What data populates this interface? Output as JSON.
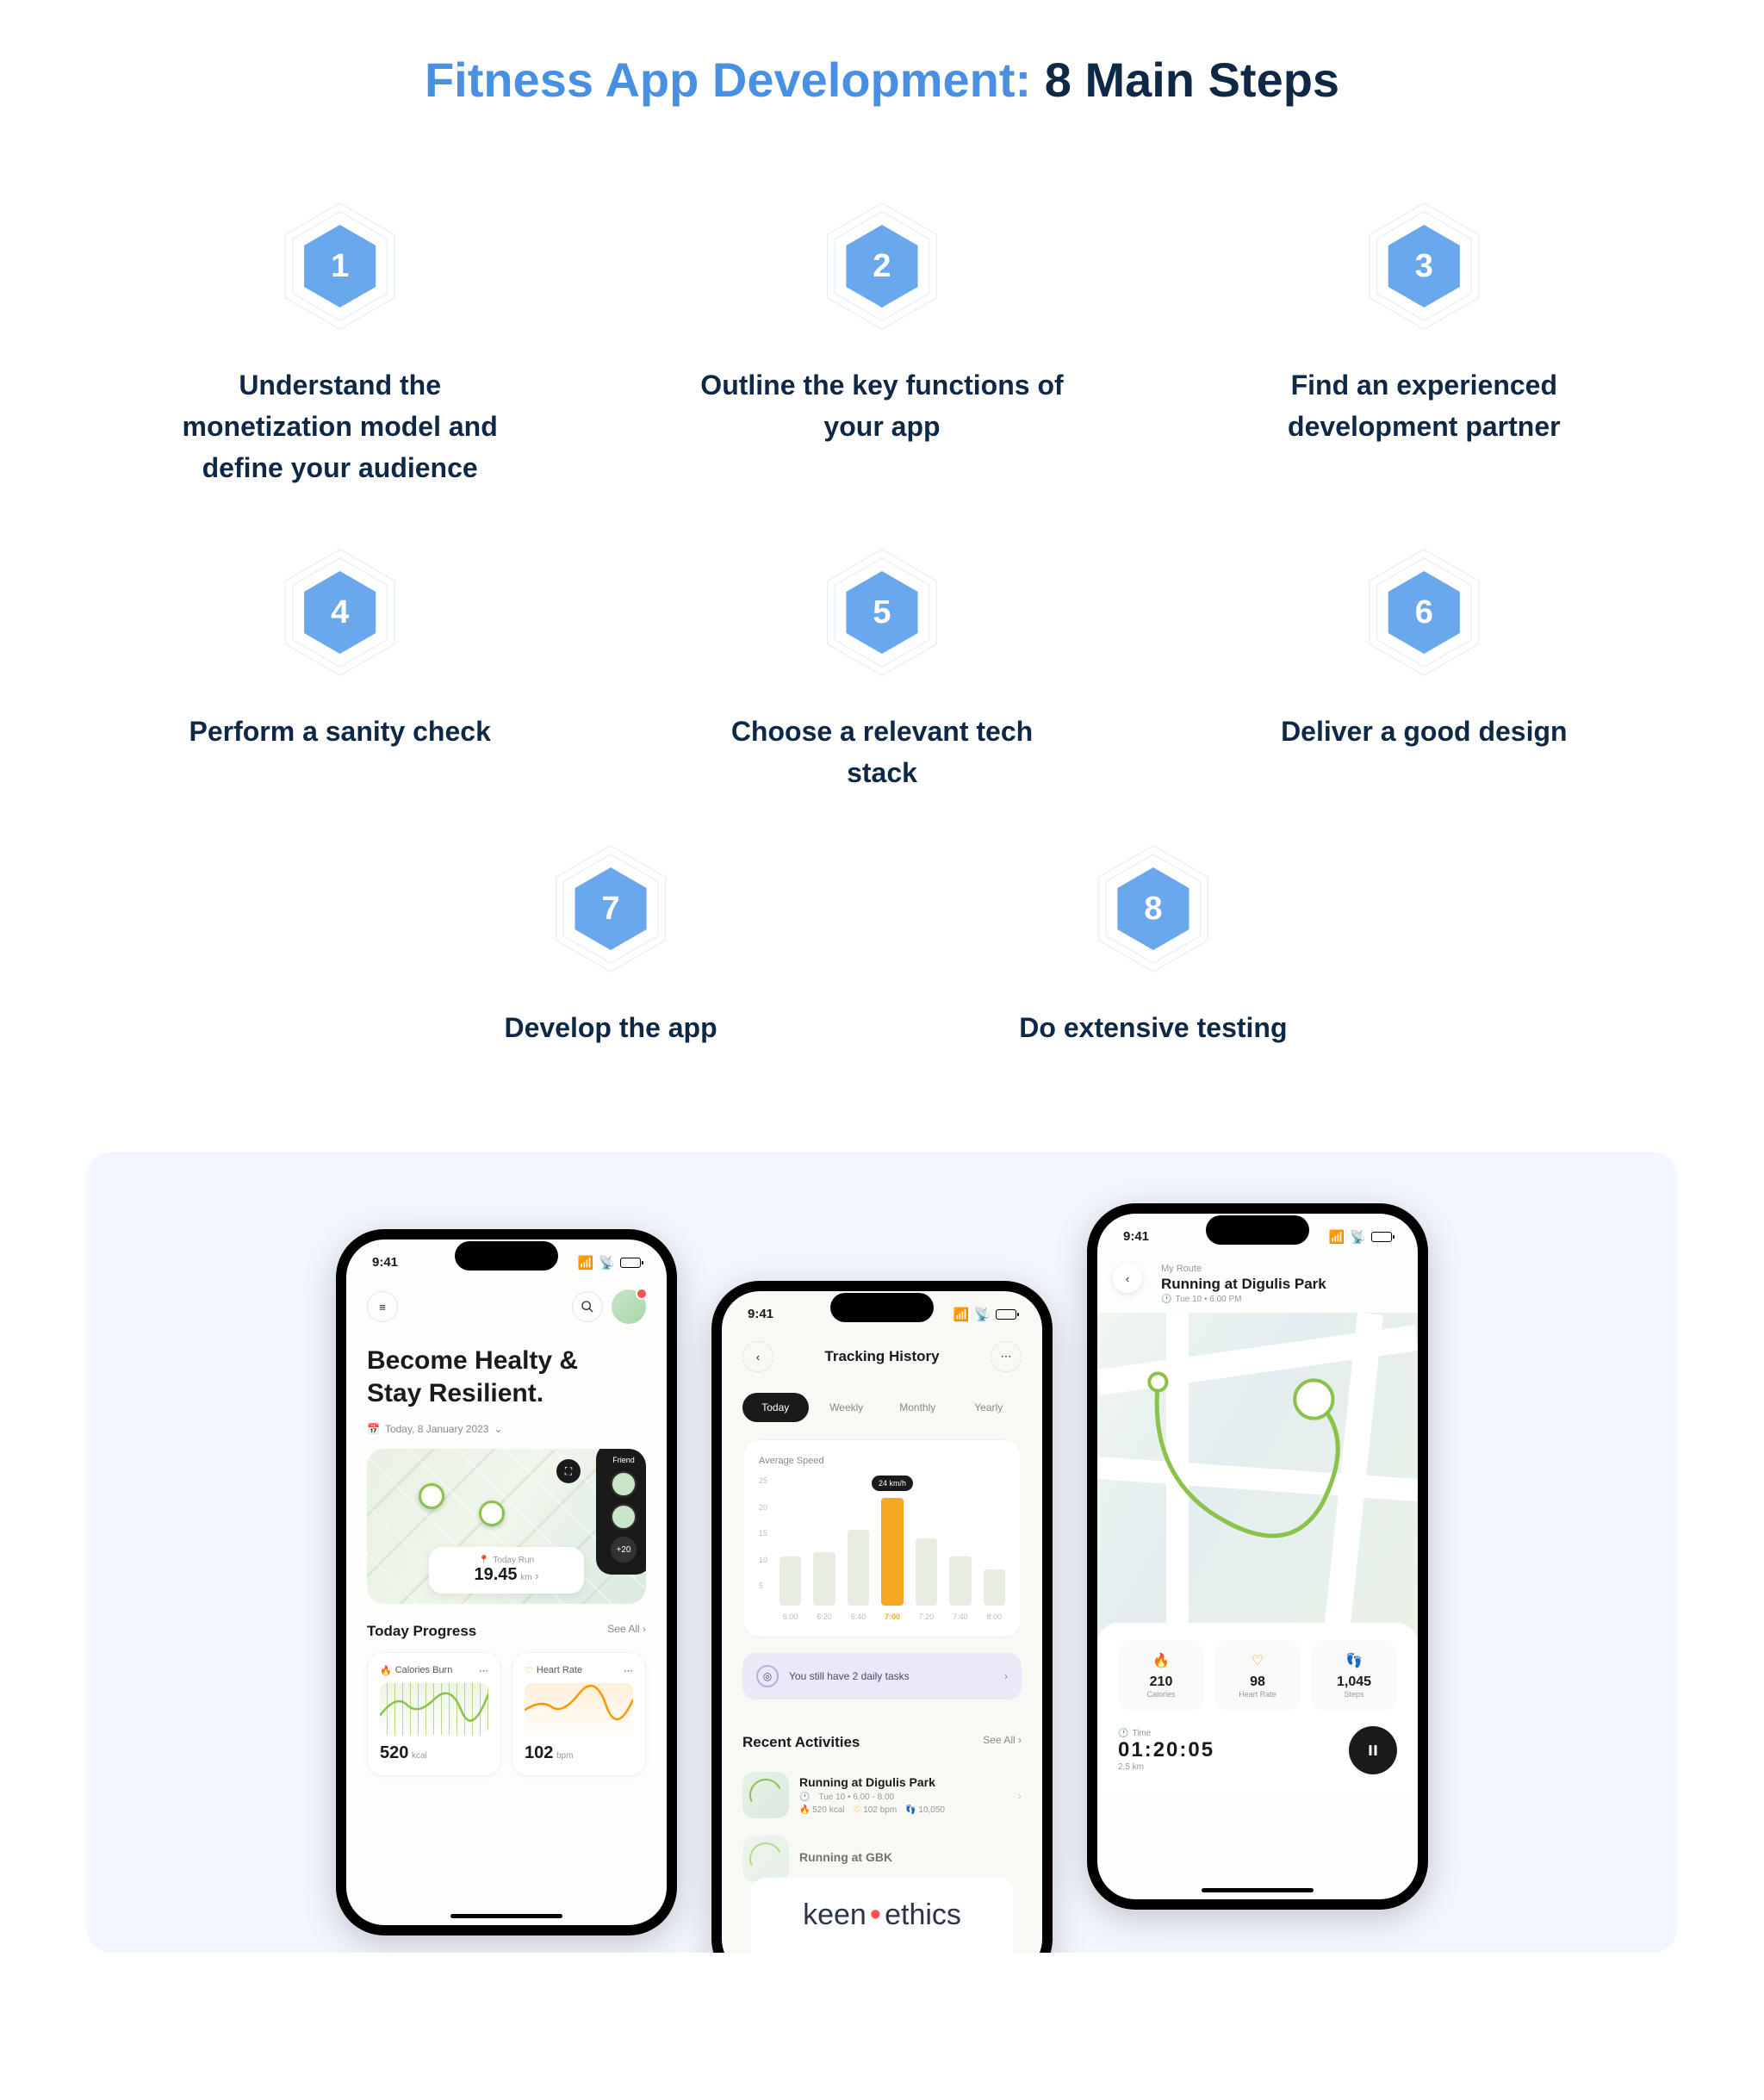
{
  "title": {
    "blue": "Fitness App Development:",
    "dark": " 8 Main Steps"
  },
  "steps": [
    {
      "num": "1",
      "label": "Understand the monetization model and define your audience"
    },
    {
      "num": "2",
      "label": "Outline the key functions of your app"
    },
    {
      "num": "3",
      "label": "Find an experienced development partner"
    },
    {
      "num": "4",
      "label": "Perform a sanity check"
    },
    {
      "num": "5",
      "label": "Choose a relevant tech stack"
    },
    {
      "num": "6",
      "label": "Deliver a good design"
    },
    {
      "num": "7",
      "label": "Develop the app"
    },
    {
      "num": "8",
      "label": "Do extensive testing"
    }
  ],
  "phone1": {
    "time": "9:41",
    "headline_l1": "Become Healty &",
    "headline_l2": "Stay Resilient.",
    "date": "Today, 8 January 2023",
    "friend_label": "Friend",
    "friend_more": "+20",
    "today_run_label": "Today Run",
    "today_run_value": "19.45",
    "today_run_unit": "km",
    "progress_title": "Today Progress",
    "see_all": "See All  ›",
    "card_cal_label": "Calories Burn",
    "card_cal_value": "520",
    "card_cal_unit": "kcal",
    "card_hr_label": "Heart Rate",
    "card_hr_value": "102",
    "card_hr_unit": "bpm"
  },
  "phone2": {
    "time": "9:41",
    "title": "Tracking History",
    "tabs": [
      "Today",
      "Weekly",
      "Monthly",
      "Yearly"
    ],
    "chart_label": "Average Speed",
    "task_text": "You still have 2 daily tasks",
    "recent_title": "Recent Activities",
    "see_all": "See All  ›",
    "act1_title": "Running at Digulis Park",
    "act1_time": "Tue 10 • 6.00 - 8.00",
    "act1_cal": "520 kcal",
    "act1_bpm": "102 bpm",
    "act1_steps": "10,050",
    "act2_title": "Running at GBK"
  },
  "chart_data": {
    "type": "bar",
    "title": "Average Speed",
    "ylabel": "km/h",
    "ylim": [
      0,
      25
    ],
    "y_ticks": [
      25,
      20,
      15,
      10,
      5
    ],
    "categories": [
      "6:00",
      "6:20",
      "6:40",
      "7:00",
      "7:20",
      "7:40",
      "8:00"
    ],
    "values": [
      11,
      12,
      17,
      24,
      15,
      11,
      8
    ],
    "highlight_index": 3,
    "highlight_label": "24 km/h"
  },
  "phone3": {
    "time": "9:41",
    "subtitle": "My Route",
    "title": "Running at Digulis Park",
    "datetime": "Tue 10 • 6.00 PM",
    "stat_cal_value": "210",
    "stat_cal_label": "Calories",
    "stat_hr_value": "98",
    "stat_hr_label": "Heart Rate",
    "stat_steps_value": "1,045",
    "stat_steps_label": "Steps",
    "time_label": "Time",
    "time_value": "01:20:05",
    "distance": "2,5 km"
  },
  "logo": {
    "part1": "keen",
    "part2": "ethics"
  }
}
